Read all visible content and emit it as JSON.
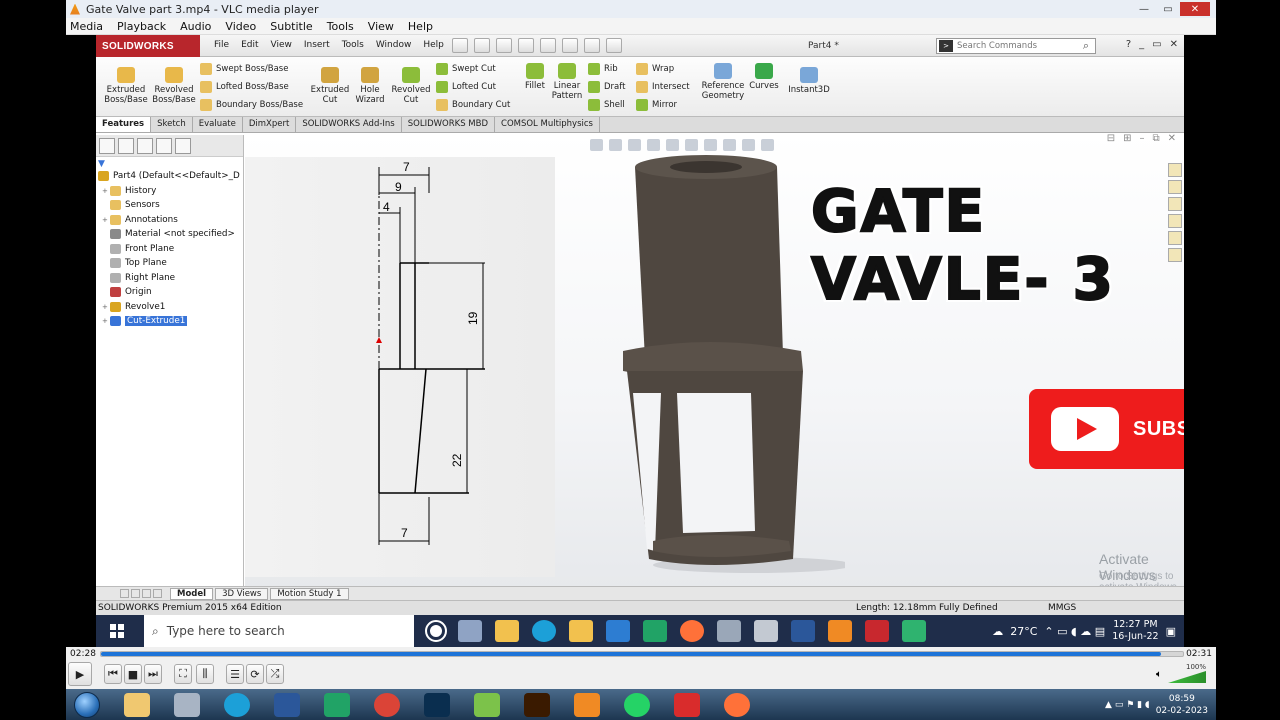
{
  "vlc": {
    "title": "Gate Valve part 3.mp4 - VLC media player",
    "menu": [
      "Media",
      "Playback",
      "Audio",
      "Video",
      "Subtitle",
      "Tools",
      "View",
      "Help"
    ],
    "time_elapsed": "02:28",
    "time_total": "02:31",
    "progress": 0.98,
    "volume": "100%"
  },
  "solidworks": {
    "logo": "SOLIDWORKS",
    "menu": [
      "File",
      "Edit",
      "View",
      "Insert",
      "Tools",
      "Window",
      "Help"
    ],
    "document": "Part4 *",
    "search_placeholder": "Search Commands",
    "ribbon": {
      "extruded_boss": "Extruded Boss/Base",
      "revolved_boss": "Revolved Boss/Base",
      "swept_boss": "Swept Boss/Base",
      "lofted_boss": "Lofted Boss/Base",
      "boundary_boss": "Boundary Boss/Base",
      "extruded_cut": "Extruded Cut",
      "hole_wizard": "Hole Wizard",
      "revolved_cut": "Revolved Cut",
      "swept_cut": "Swept Cut",
      "lofted_cut": "Lofted Cut",
      "boundary_cut": "Boundary Cut",
      "fillet": "Fillet",
      "linear_pattern": "Linear Pattern",
      "rib": "Rib",
      "draft": "Draft",
      "shell": "Shell",
      "wrap": "Wrap",
      "intersect": "Intersect",
      "mirror": "Mirror",
      "reference_geometry": "Reference Geometry",
      "curves": "Curves",
      "instant3d": "Instant3D"
    },
    "tabs": [
      "Features",
      "Sketch",
      "Evaluate",
      "DimXpert",
      "SOLIDWORKS Add-Ins",
      "SOLIDWORKS MBD",
      "COMSOL Multiphysics"
    ],
    "tree": [
      {
        "label": "Part4  (Default<<Default>_D",
        "color": "#d9a520"
      },
      {
        "label": "History",
        "color": "#e8c060"
      },
      {
        "label": "Sensors",
        "color": "#e8c060"
      },
      {
        "label": "Annotations",
        "color": "#e8c060"
      },
      {
        "label": "Material <not specified>",
        "color": "#8a8a8a"
      },
      {
        "label": "Front Plane",
        "color": "#b0b0b0"
      },
      {
        "label": "Top Plane",
        "color": "#b0b0b0"
      },
      {
        "label": "Right Plane",
        "color": "#b0b0b0"
      },
      {
        "label": "Origin",
        "color": "#c04040"
      },
      {
        "label": "Revolve1",
        "color": "#d9a520"
      },
      {
        "label": "Cut-Extrude1",
        "color": "#3874d8"
      }
    ],
    "dimensions": {
      "top": "7",
      "nine": "9",
      "four": "4",
      "nineteen": "19",
      "twentytwo": "22",
      "bottom": "7"
    },
    "bottom_tabs": [
      "Model",
      "3D Views",
      "Motion Study 1"
    ],
    "status": {
      "edition": "SOLIDWORKS Premium 2015 x64 Edition",
      "length": "Length: 12.18mm",
      "defined": "Fully Defined",
      "units": "MMGS"
    }
  },
  "overlay": {
    "title": "GATE VAVLE- 3",
    "subscribe": "SUBSCRIBE",
    "activate": "Activate Windows",
    "activate_sub": "Go to Settings to activate Windows."
  },
  "taskbar10": {
    "search": "Type here to search",
    "temp": "27°C",
    "time": "12:27 PM",
    "date": "16-Jun-22"
  },
  "taskbar7": {
    "time": "08:59",
    "date": "02-02-2023"
  },
  "colors": {
    "part_body": "#4f4740",
    "youtube_red": "#ee1c1c",
    "vlc_seek": "#1d74d8",
    "sw_red": "#b8262c"
  }
}
